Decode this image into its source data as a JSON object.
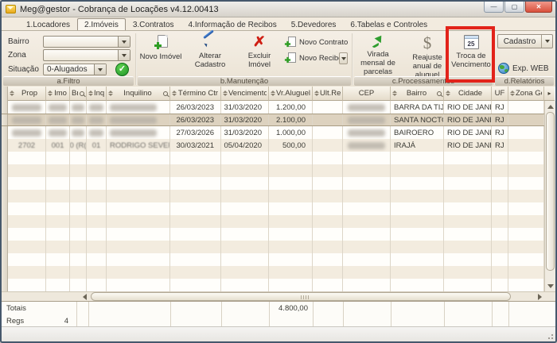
{
  "window": {
    "title": "Meg@gestor - Cobrança de Locações v4.12.00413"
  },
  "colors": {
    "highlight_red": "#e2231a",
    "check_green": "#1f9427",
    "selected_row": "#ddd2bf"
  },
  "tabs": [
    {
      "label": "1.Locadores",
      "active": false
    },
    {
      "label": "2.Imóveis",
      "active": true
    },
    {
      "label": "3.Contratos",
      "active": false
    },
    {
      "label": "4.Informação de Recibos",
      "active": false
    },
    {
      "label": "5.Devedores",
      "active": false
    },
    {
      "label": "6.Tabelas e Controles",
      "active": false
    }
  ],
  "filter": {
    "section_label": "a.Filtro",
    "bairro_label": "Bairro",
    "zona_label": "Zona",
    "situacao_label": "Situação",
    "situacao_value": "0-Alugados"
  },
  "toolbar": {
    "manutencao": {
      "section_label": "b.Manutenção",
      "novo_imovel": "Novo Imóvel",
      "alterar_cadastro": "Alterar Cadastro",
      "excluir_imovel": "Excluir Imóvel",
      "novo_contrato": "Novo Contrato",
      "novo_recibo": "Novo Recibo"
    },
    "processamentos": {
      "section_label": "c.Processamentos",
      "virada_mensal": "Virada mensal de parcelas",
      "reajuste_anual": "Reajuste anual de aluguel",
      "troca_vencimento": "Troca de Vencimento",
      "troca_calendar_day": "25"
    },
    "relatorios": {
      "section_label": "d.Relatórios",
      "cadastro": "Cadastro",
      "exp_web": "Exp. WEB"
    }
  },
  "grid": {
    "columns": [
      {
        "label": "Prop",
        "sort": true,
        "search": false,
        "align": "c"
      },
      {
        "label": "Imo",
        "sort": true,
        "search": false,
        "align": "c"
      },
      {
        "label": "Bri",
        "sort": false,
        "search": true,
        "align": "c"
      },
      {
        "label": "Inq",
        "sort": true,
        "search": false,
        "align": "c"
      },
      {
        "label": "Inquilino",
        "sort": true,
        "search": true,
        "align": "l"
      },
      {
        "label": "Término Ctr",
        "sort": true,
        "search": false,
        "align": "r"
      },
      {
        "label": "Vencimento",
        "sort": true,
        "search": false,
        "align": "r"
      },
      {
        "label": "Vr.Aluguel",
        "sort": true,
        "search": false,
        "align": "r"
      },
      {
        "label": "Ult.Reaj.",
        "sort": true,
        "search": false,
        "align": "r"
      },
      {
        "label": "CEP",
        "sort": false,
        "search": false,
        "align": "c"
      },
      {
        "label": "Bairro",
        "sort": true,
        "search": true,
        "align": "l"
      },
      {
        "label": "Cidade",
        "sort": true,
        "search": false,
        "align": "l"
      },
      {
        "label": "UF",
        "sort": false,
        "search": false,
        "align": "l"
      },
      {
        "label": "Zona Geo",
        "sort": true,
        "search": false,
        "align": "l"
      }
    ],
    "rows": [
      {
        "selected": false,
        "cells": [
          {
            "blur": "block"
          },
          {
            "blur": "block"
          },
          {
            "blur": "block"
          },
          {
            "blur": "block"
          },
          {
            "blur": "block"
          },
          {
            "v": "26/03/2023"
          },
          {
            "v": "31/03/2020"
          },
          {
            "v": "1.200,00"
          },
          {
            "v": ""
          },
          {
            "blur": "block"
          },
          {
            "v": "BARRA DA TIJUCA"
          },
          {
            "v": "RIO DE JANEIRO"
          },
          {
            "v": "RJ"
          },
          {
            "v": ""
          }
        ]
      },
      {
        "selected": true,
        "cells": [
          {
            "blur": "block"
          },
          {
            "blur": "block"
          },
          {
            "blur": "block"
          },
          {
            "blur": "block"
          },
          {
            "blur": "block"
          },
          {
            "v": "26/03/2023"
          },
          {
            "v": "31/03/2020"
          },
          {
            "v": "2.100,00"
          },
          {
            "v": ""
          },
          {
            "blur": "block"
          },
          {
            "v": "SANTA NOCTÓRIA"
          },
          {
            "v": "RIO DE JANEIRO"
          },
          {
            "v": "RJ"
          },
          {
            "v": ""
          }
        ]
      },
      {
        "selected": false,
        "cells": [
          {
            "blur": "block"
          },
          {
            "blur": "block"
          },
          {
            "blur": "block"
          },
          {
            "blur": "block"
          },
          {
            "blur": "block"
          },
          {
            "v": "27/03/2026"
          },
          {
            "v": "31/03/2020"
          },
          {
            "v": "1.000,00"
          },
          {
            "v": ""
          },
          {
            "blur": "block"
          },
          {
            "v": "BAIROERO"
          },
          {
            "v": "RIO DE JANEIRO"
          },
          {
            "v": "RJ"
          },
          {
            "v": ""
          }
        ]
      },
      {
        "selected": false,
        "cells": [
          {
            "v": "2702",
            "blur": "light"
          },
          {
            "v": "001",
            "blur": "light"
          },
          {
            "v": "0 (R(",
            "blur": "light"
          },
          {
            "v": "01",
            "blur": "light"
          },
          {
            "v": "RODRIGO SEVERINO",
            "blur": "light"
          },
          {
            "v": "30/03/2021"
          },
          {
            "v": "05/04/2020"
          },
          {
            "v": "500,00"
          },
          {
            "v": ""
          },
          {
            "blur": "block"
          },
          {
            "v": "IRAJÁ"
          },
          {
            "v": "RIO DE JANEIRO"
          },
          {
            "v": "RJ"
          },
          {
            "v": ""
          }
        ]
      }
    ]
  },
  "footer": {
    "totais_label": "Totais",
    "total_vr_aluguel": "4.800,00",
    "regs_label": "Regs",
    "regs_count": "4"
  }
}
